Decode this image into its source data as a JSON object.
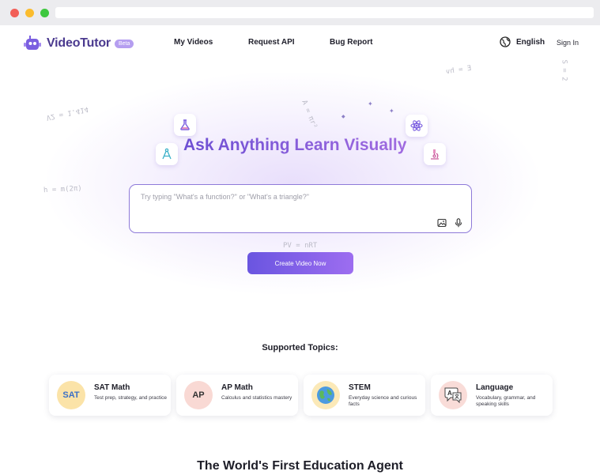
{
  "brand": {
    "name": "VideoTutor",
    "badge": "Beta"
  },
  "nav": {
    "links": [
      "My Videos",
      "Request API",
      "Bug Report"
    ],
    "language": "English",
    "sign_in": "Sign In"
  },
  "hero": {
    "title": "Ask Anything Learn Visually",
    "placeholder": "Try typing \"What's a function?\" or \"What's a triangle?\"",
    "cta": "Create Video Now"
  },
  "background_formulas": [
    "V2 = 1.414",
    "A = πr²",
    "E = hν",
    "h = m(2π)",
    "PV = nRT",
    "S = 2"
  ],
  "topics": {
    "title": "Supported Topics:",
    "items": [
      {
        "icon_text": "SAT",
        "title": "SAT Math",
        "desc": "Test prep, strategy, and practice",
        "color": "#fbe3a8"
      },
      {
        "icon_text": "AP",
        "title": "AP Math",
        "desc": "Calculus and statistics mastery",
        "color": "#f9d9d4"
      },
      {
        "icon_text": "",
        "title": "STEM",
        "desc": "Everyday science and curious facts",
        "color": "#fbe9b8"
      },
      {
        "icon_text": "",
        "title": "Language",
        "desc": "Vocabulary, grammar, and speaking skills",
        "color": "#f9dcd8"
      }
    ]
  },
  "footer_heading": "The World's First Education Agent",
  "colors": {
    "accent": "#6f55d6",
    "button_start": "#6a55e0",
    "button_end": "#9d6df0"
  }
}
